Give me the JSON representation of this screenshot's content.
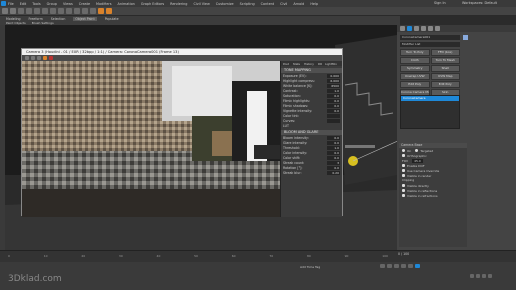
{
  "titlebar": {
    "menu": [
      "File",
      "Edit",
      "Tools",
      "Group",
      "Views",
      "Create",
      "Modifiers",
      "Animation",
      "Graph Editors",
      "Rendering",
      "Civil View",
      "Customize",
      "Scripting",
      "Content",
      "Civil",
      "Arnold",
      "Help"
    ],
    "sign_in": "Sign In",
    "workspaces": "Workspaces: Default"
  },
  "toolbar2": {
    "tabs": [
      "Modeling",
      "Freeform",
      "Selection",
      "Object Paint",
      "Populate"
    ],
    "subtabs": [
      "Paint Objects",
      "Brush Settings"
    ]
  },
  "viewport": {
    "label": "[+] [Camera001] [Standard] [Default Shading]"
  },
  "render_window": {
    "title": "Camera 3 (Houdini - 01 / EXR / 32bpp / 1:1) / Camera: CoronaCamera001 (Frame 13)",
    "tools_tabs": [
      "File",
      "Post",
      "Stats",
      "History",
      "DR",
      "LightMix"
    ],
    "panel_tabs": [
      "Post",
      "Stats",
      "History",
      "DR",
      "LightMix"
    ],
    "tone_mapping": {
      "header": "TONE MAPPING",
      "rows": [
        {
          "label": "Exposure (EV):",
          "value": "0.000"
        },
        {
          "label": "Highlight compress:",
          "value": "6.000"
        },
        {
          "label": "White balance [K]:",
          "value": "6500"
        },
        {
          "label": "Contrast:",
          "value": "1.0"
        },
        {
          "label": "Saturation:",
          "value": "0.0"
        },
        {
          "label": "Filmic highlights:",
          "value": "0.0"
        },
        {
          "label": "Filmic shadows:",
          "value": "0.0"
        },
        {
          "label": "Vignette intensity:",
          "value": "0.0"
        },
        {
          "label": "Color tint:",
          "value": ""
        },
        {
          "label": "Curves:",
          "value": ""
        }
      ]
    },
    "lut_label": "LUT",
    "bloom_glare": {
      "header": "BLOOM AND GLARE",
      "rows": [
        {
          "label": "Bloom intensity:",
          "value": "0.0"
        },
        {
          "label": "Glare intensity:",
          "value": "0.0"
        },
        {
          "label": "Threshold:",
          "value": "1.0"
        },
        {
          "label": "Color intensity:",
          "value": "0.0"
        },
        {
          "label": "Color shift:",
          "value": "0.0"
        },
        {
          "label": "Streak count:",
          "value": "3"
        },
        {
          "label": "Rotation [°]:",
          "value": "0.0"
        },
        {
          "label": "Streak blur:",
          "value": "0.20"
        }
      ]
    }
  },
  "cmdpanel": {
    "object_name": "CoronaCamera001",
    "modifier_list": "Modifier List",
    "buttons": [
      "Turn To Poly",
      "FFD (box)",
      "Cloth",
      "Turn To Mesh",
      "Symmetry",
      "Shell",
      "Unwrap UVW",
      "UVW Map",
      "Edit Poly",
      "Edit Poly",
      "Corona Camera Mod",
      "Skin"
    ],
    "stack_item": "CoronaCamera",
    "camera_section": "Camera Base",
    "cam_options": [
      "On",
      "Targeted"
    ],
    "ortho_label": "Orthographic",
    "fov_label": "FOV",
    "fov_value": "45.0",
    "use_dof_label": "Enable DOF",
    "use_cam_label": "Use Camera Override",
    "visible_label": "Visible in render",
    "clipping": "Clipping",
    "visibility_items": [
      "Visible directly",
      "Visible in reflections",
      "Visible in refractions"
    ]
  },
  "timeline": {
    "ticks": [
      "0",
      "10",
      "20",
      "30",
      "40",
      "50",
      "60",
      "70",
      "80",
      "90",
      "100"
    ],
    "frame_counter": "0 / 100",
    "add_time_tag": "Add Time Tag"
  },
  "status": {
    "watermark": "3Dklad.com"
  }
}
